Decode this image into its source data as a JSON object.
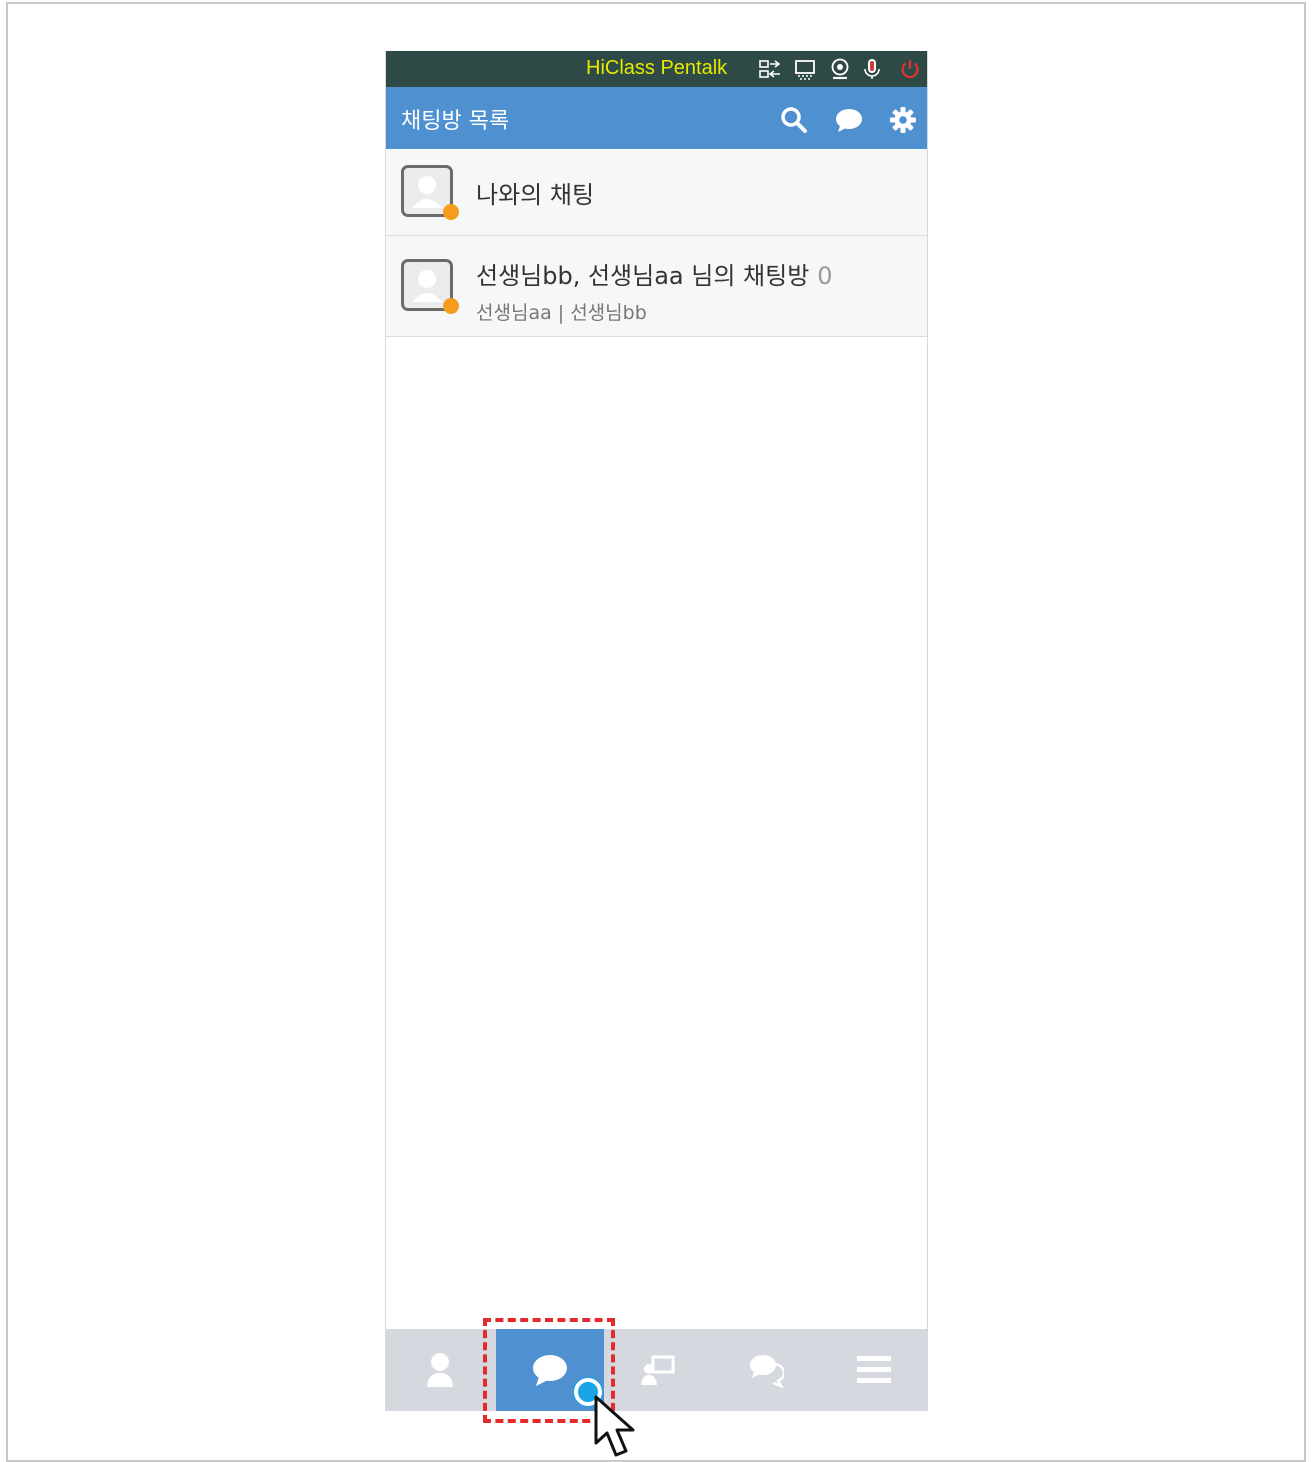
{
  "app": {
    "window_title": "HiClass Pentalk"
  },
  "header": {
    "title": "채팅방 목록"
  },
  "chat_list": [
    {
      "name": "나와의 채팅",
      "count": "",
      "members": ""
    },
    {
      "name": "선생님bb, 선생님aa 님의 채팅방",
      "count": "0",
      "members": "선생님aa | 선생님bb"
    }
  ],
  "bottom_nav": {
    "items": [
      "friends-icon",
      "chat-icon",
      "classroom-icon",
      "conversation-icon",
      "menu-icon"
    ],
    "active": "chat-icon"
  },
  "colors": {
    "titlebar": "#2e4a47",
    "header": "#4f90d0",
    "title_text": "#e8e800",
    "status_dot": "#f59b1e",
    "highlight": "#e42a2a"
  }
}
